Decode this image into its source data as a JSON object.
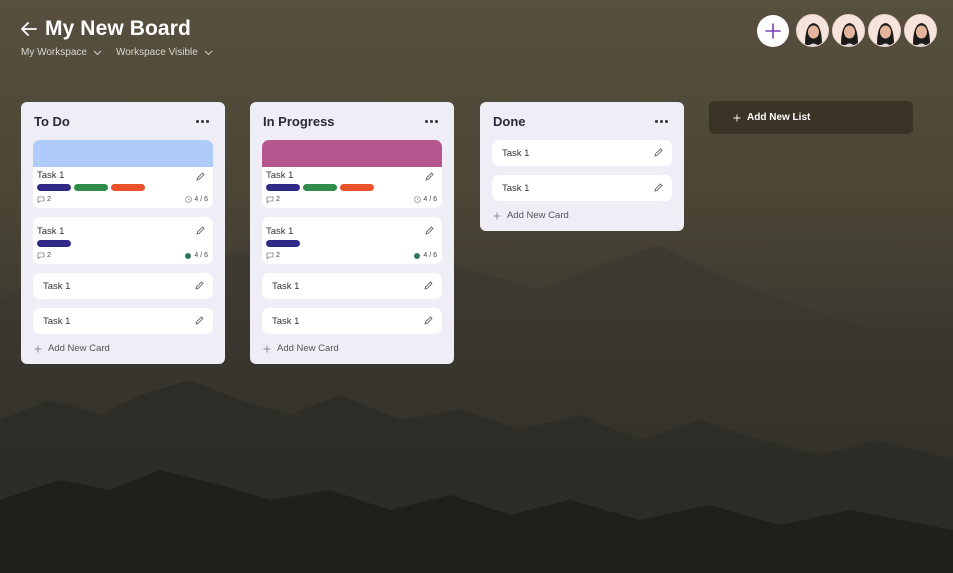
{
  "header": {
    "title": "My New Board",
    "workspace": "My Workspace",
    "visibility": "Workspace Visible"
  },
  "members": {
    "count": 4
  },
  "lists": [
    {
      "title": "To Do",
      "add_card_label": "Add New Card",
      "cards": [
        {
          "title": "Task 1",
          "cover": "#aecbfa",
          "labels": [
            "#2e2a86",
            "#2e8b4a",
            "#e9522b"
          ],
          "comments": "2",
          "progress": "4 / 6"
        },
        {
          "title": "Task 1",
          "labels": [
            "#2e2a86"
          ],
          "comments": "2",
          "progress": "4 / 6"
        },
        {
          "title": "Task 1"
        },
        {
          "title": "Task 1"
        }
      ]
    },
    {
      "title": "In Progress",
      "add_card_label": "Add New Card",
      "cards": [
        {
          "title": "Task 1",
          "cover": "#b5568f",
          "labels": [
            "#2e2a86",
            "#2e8b4a",
            "#e9522b"
          ],
          "comments": "2",
          "progress": "4 / 6"
        },
        {
          "title": "Task 1",
          "labels": [
            "#2e2a86"
          ],
          "comments": "2",
          "progress": "4 / 6"
        },
        {
          "title": "Task 1"
        },
        {
          "title": "Task 1"
        }
      ]
    },
    {
      "title": "Done",
      "add_card_label": "Add New Card",
      "cards": [
        {
          "title": "Task 1"
        },
        {
          "title": "Task 1"
        }
      ]
    }
  ],
  "add_list_label": "Add New List",
  "colors": {
    "list_bg": "#efedf6",
    "add_list_bg": "#3b3326",
    "accent": "#7b3fb5",
    "progress_dot": "#2f7a5e"
  },
  "icons": [
    "back-arrow-icon",
    "chevron-down-icon",
    "plus-icon",
    "more-icon",
    "pencil-icon",
    "comment-icon",
    "clock-icon"
  ]
}
